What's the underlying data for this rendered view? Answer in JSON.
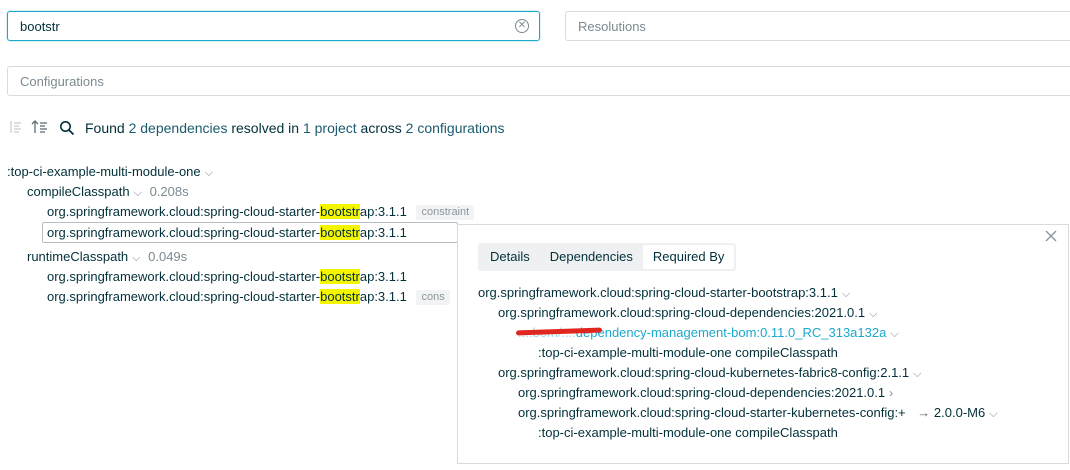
{
  "filters": {
    "search_value": "bootstr",
    "resolutions_placeholder": "Resolutions",
    "configurations_placeholder": "Configurations"
  },
  "summary": {
    "pre": "Found ",
    "deps_count": "2 dependencies",
    "mid1": " resolved in ",
    "project_count": "1 project",
    "mid2": " across ",
    "config_count": "2 configurations"
  },
  "tree": {
    "project": ":top-ci-example-multi-module-one",
    "compile": {
      "name": "compileClasspath",
      "time": "0.208s"
    },
    "runtime": {
      "name": "runtimeClasspath",
      "time": "0.049s"
    },
    "dep_prefix": "org.springframework.cloud:spring-cloud-starter-",
    "dep_match": "bootstr",
    "dep_suffix": "ap:3.1.1",
    "constraint_badge": "constraint",
    "constraint_badge_clipped": "cons"
  },
  "panel": {
    "tabs": [
      "Details",
      "Dependencies",
      "Required By"
    ],
    "active_tab": "Required By",
    "lines": {
      "l1": "org.springframework.cloud:spring-cloud-starter-bootstrap:3.1.1",
      "l2": "org.springframework.cloud:spring-cloud-dependencies:2021.0.1",
      "l3_obscured": "...:bom/...:",
      "l3_link": "dependency-management-bom:0.11.0_RC_313a132a",
      "l4": ":top-ci-example-multi-module-one compileClasspath",
      "l5": "org.springframework.cloud:spring-cloud-kubernetes-fabric8-config:2.1.1",
      "l6": "org.springframework.cloud:spring-cloud-dependencies:2021.0.1",
      "l7": "org.springframework.cloud:spring-cloud-starter-kubernetes-config:+",
      "l7_arrow": "→",
      "l7_version": "2.0.0-M6",
      "l8": ":top-ci-example-multi-module-one compileClasspath"
    }
  },
  "colors": {
    "accent": "#1ba8cb",
    "highlight": "#f5f500",
    "text": "#02303a",
    "muted": "#7a8a91",
    "redaction": "#e0261e"
  },
  "icons": [
    "clear-icon",
    "collapse-all-icon",
    "expand-all-icon",
    "search-icon",
    "chevron-down-icon",
    "chevron-right-icon",
    "close-icon"
  ]
}
